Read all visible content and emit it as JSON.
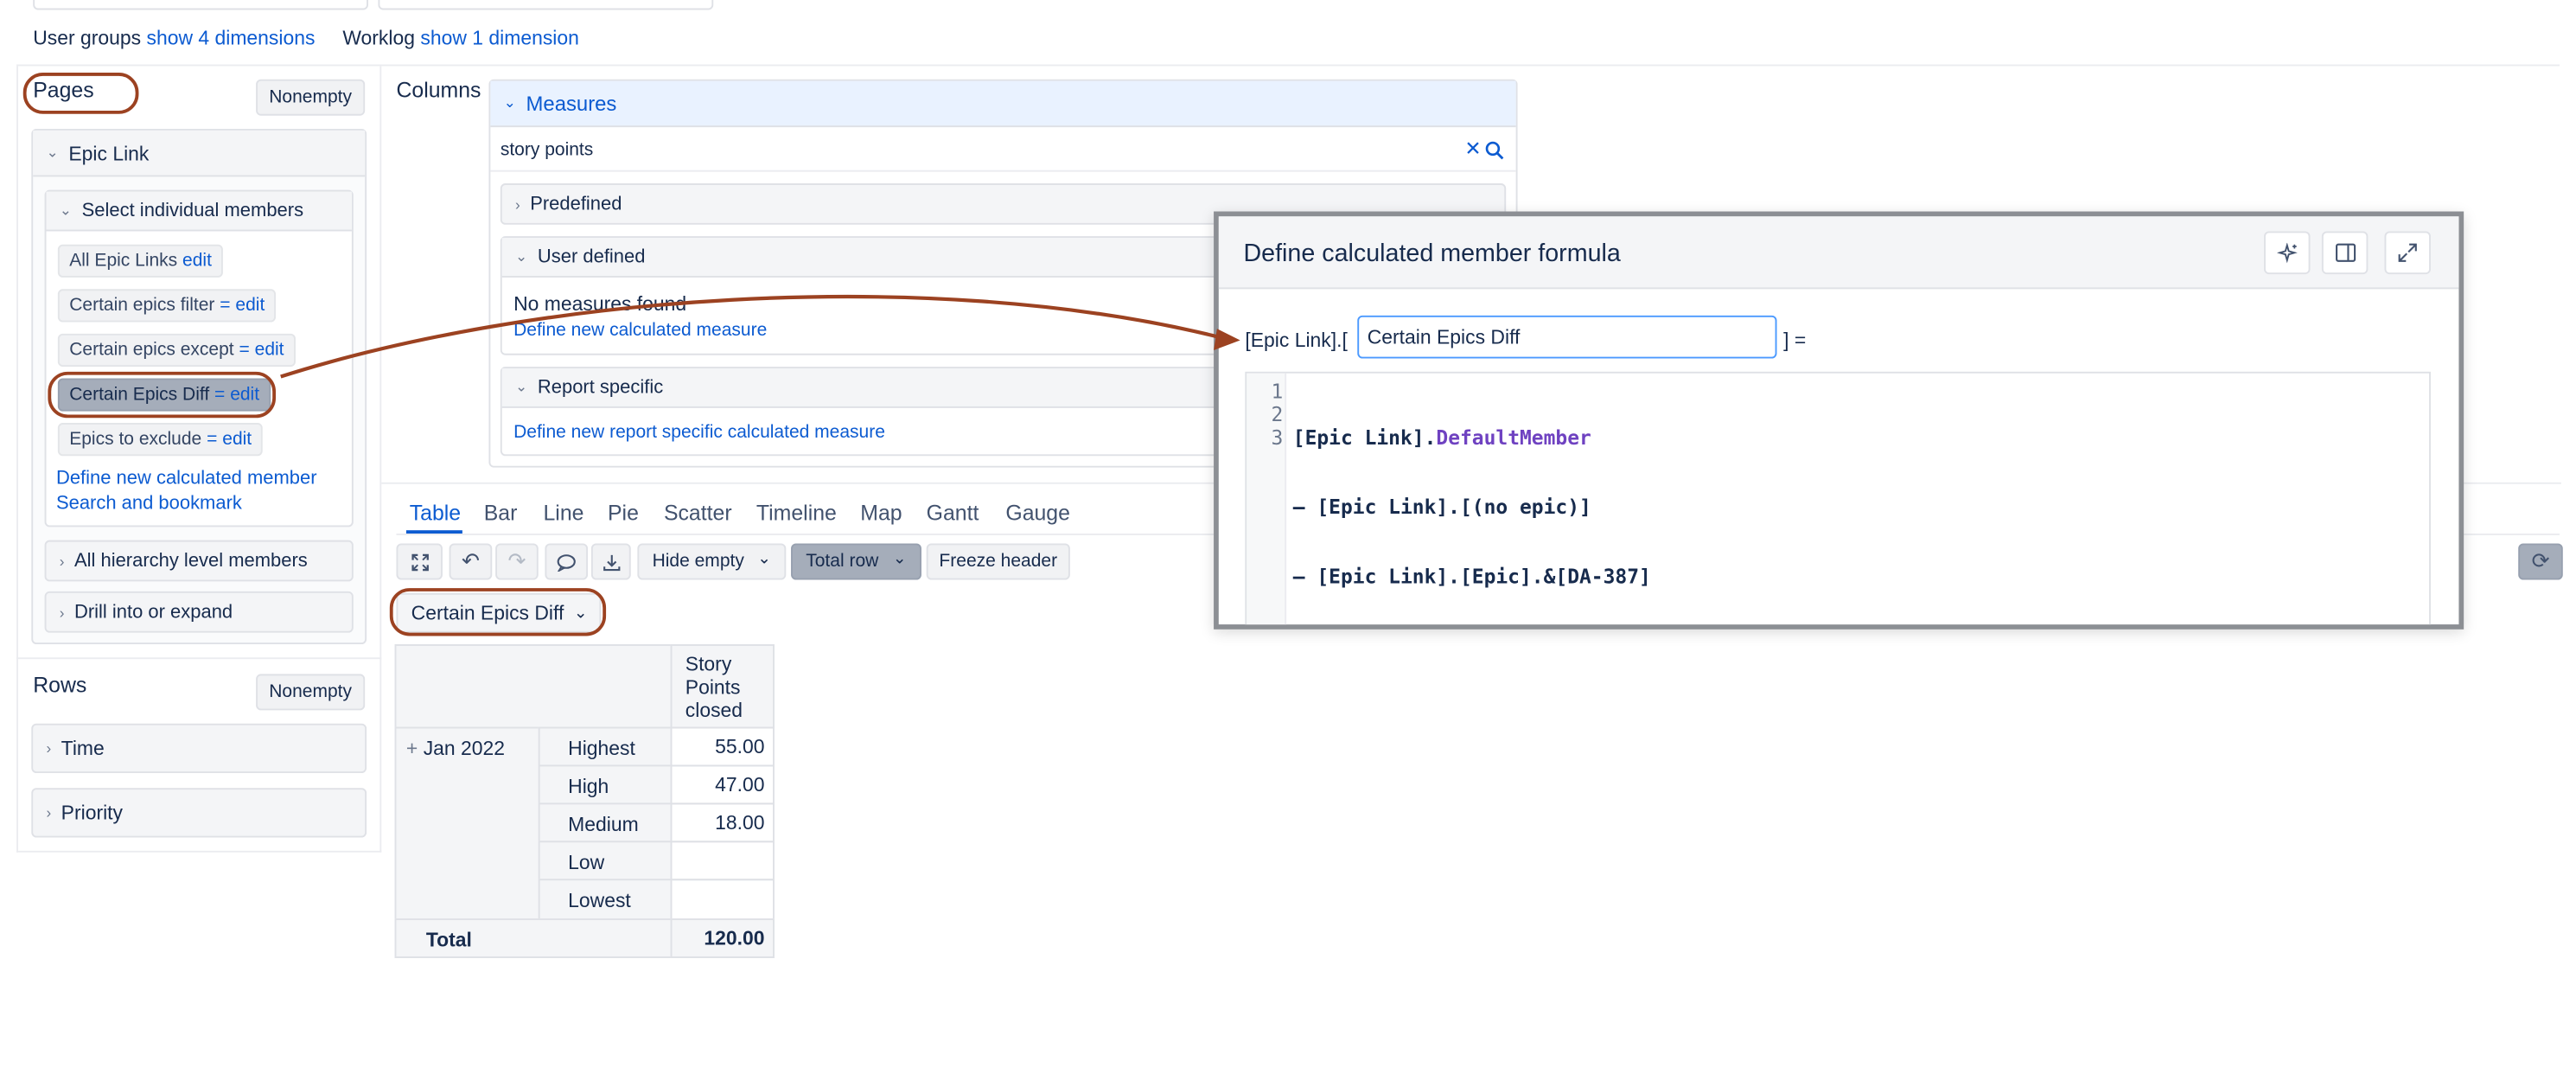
{
  "dimensions": {
    "user_groups_label": "User groups",
    "user_groups_link": "show 4 dimensions",
    "worklog_label": "Worklog",
    "worklog_link": "show 1 dimension"
  },
  "pages": {
    "title": "Pages",
    "nonempty": "Nonempty",
    "epic_link": "Epic Link",
    "select_individual": "Select individual members",
    "members": [
      {
        "label": "All Epic Links",
        "edit": "edit",
        "eq": ""
      },
      {
        "label": "Certain epics filter",
        "edit": "edit",
        "eq": "="
      },
      {
        "label": "Certain epics except",
        "edit": "edit",
        "eq": "="
      },
      {
        "label": "Certain Epics Diff",
        "edit": "edit",
        "eq": "="
      },
      {
        "label": "Epics to exclude",
        "edit": "edit",
        "eq": "="
      }
    ],
    "define_new": "Define new calculated member",
    "search_bookmark": "Search and bookmark",
    "all_hierarchy": "All hierarchy level members",
    "drill": "Drill into or expand"
  },
  "rows": {
    "title": "Rows",
    "nonempty": "Nonempty",
    "time": "Time",
    "priority": "Priority"
  },
  "columns": {
    "title": "Columns",
    "measures": "Measures",
    "search_value": "story points",
    "predefined": "Predefined",
    "user_defined": "User defined",
    "no_measures": "No measures found",
    "define_new_measure": "Define new calculated measure",
    "report_specific": "Report specific",
    "define_report_measure": "Define new report specific calculated measure"
  },
  "view_tabs": [
    "Table",
    "Bar",
    "Line",
    "Pie",
    "Scatter",
    "Timeline",
    "Map",
    "Gantt",
    "Gauge"
  ],
  "toolbar": {
    "hide_empty": "Hide empty",
    "total_row": "Total row",
    "freeze_header": "Freeze header"
  },
  "page_selector": "Certain Epics Diff",
  "table": {
    "header": [
      "Story",
      "Points",
      "closed"
    ],
    "period": "Jan 2022",
    "rows": [
      {
        "label": "Highest",
        "value": "55.00"
      },
      {
        "label": "High",
        "value": "47.00"
      },
      {
        "label": "Medium",
        "value": "18.00"
      },
      {
        "label": "Low",
        "value": ""
      },
      {
        "label": "Lowest",
        "value": ""
      }
    ],
    "total_label": "Total",
    "total_value": "120.00"
  },
  "dialog": {
    "title": "Define calculated member formula",
    "prefix": "[Epic Link].[",
    "name_value": "Certain Epics Diff",
    "suffix": "] =",
    "line_numbers": [
      "1",
      "2",
      "3"
    ],
    "line1_a": "[Epic Link].",
    "line1_b": "DefaultMember",
    "line2": "– [Epic Link].[(no epic)]",
    "line3": "– [Epic Link].[Epic].&[DA-387]"
  },
  "colors": {
    "link": "#0c5bd1",
    "highlight_ring": "#9c4221",
    "keyword": "#6f42c1"
  }
}
